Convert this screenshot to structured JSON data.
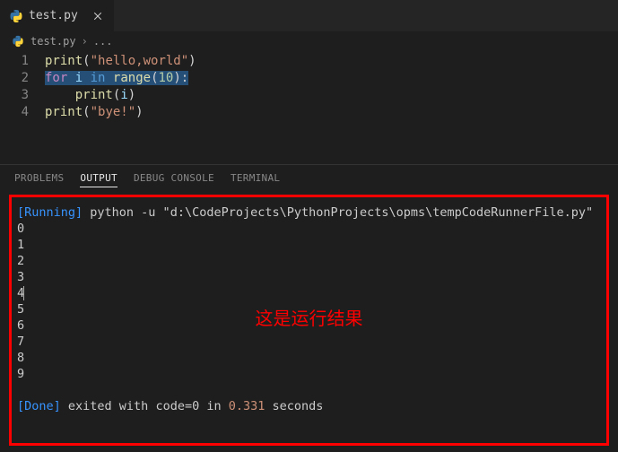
{
  "tab": {
    "filename": "test.py"
  },
  "breadcrumb": {
    "filename": "test.py",
    "more": "..."
  },
  "editor": {
    "lines": [
      {
        "num": "1",
        "tokens": [
          {
            "t": "print",
            "c": "tok-fn"
          },
          {
            "t": "(",
            "c": "tok-punc"
          },
          {
            "t": "\"hello,world\"",
            "c": "tok-str"
          },
          {
            "t": ")",
            "c": "tok-punc"
          }
        ],
        "selected": false
      },
      {
        "num": "2",
        "tokens": [
          {
            "t": "for",
            "c": "tok-kw"
          },
          {
            "t": " ",
            "c": ""
          },
          {
            "t": "i",
            "c": "tok-var"
          },
          {
            "t": " ",
            "c": ""
          },
          {
            "t": "in",
            "c": "tok-kw2"
          },
          {
            "t": " ",
            "c": ""
          },
          {
            "t": "range",
            "c": "tok-fn"
          },
          {
            "t": "(",
            "c": "tok-punc"
          },
          {
            "t": "10",
            "c": "tok-num"
          },
          {
            "t": ")",
            "c": "tok-punc"
          },
          {
            "t": ":",
            "c": "tok-punc"
          }
        ],
        "selected": true
      },
      {
        "num": "3",
        "tokens": [
          {
            "t": "    ",
            "c": ""
          },
          {
            "t": "print",
            "c": "tok-fn"
          },
          {
            "t": "(",
            "c": "tok-punc"
          },
          {
            "t": "i",
            "c": "tok-var"
          },
          {
            "t": ")",
            "c": "tok-punc"
          }
        ],
        "selected": false
      },
      {
        "num": "4",
        "tokens": [
          {
            "t": "print",
            "c": "tok-fn"
          },
          {
            "t": "(",
            "c": "tok-punc"
          },
          {
            "t": "\"bye!\"",
            "c": "tok-str"
          },
          {
            "t": ")",
            "c": "tok-punc"
          }
        ],
        "selected": false
      }
    ]
  },
  "panel": {
    "tabs": {
      "problems": "PROBLEMS",
      "output": "OUTPUT",
      "debug": "DEBUG CONSOLE",
      "terminal": "TERMINAL"
    }
  },
  "output": {
    "running_label": "[Running]",
    "running_cmd": " python -u \"d:\\CodeProjects\\PythonProjects\\opms\\tempCodeRunnerFile.py\"",
    "lines": [
      "0",
      "1",
      "2",
      "3",
      "4",
      "5",
      "6",
      "7",
      "8",
      "9"
    ],
    "done_label": "[Done]",
    "done_text1": " exited with code=0 in ",
    "done_seconds": "0.331",
    "done_text2": " seconds"
  },
  "annotation": "这是运行结果"
}
